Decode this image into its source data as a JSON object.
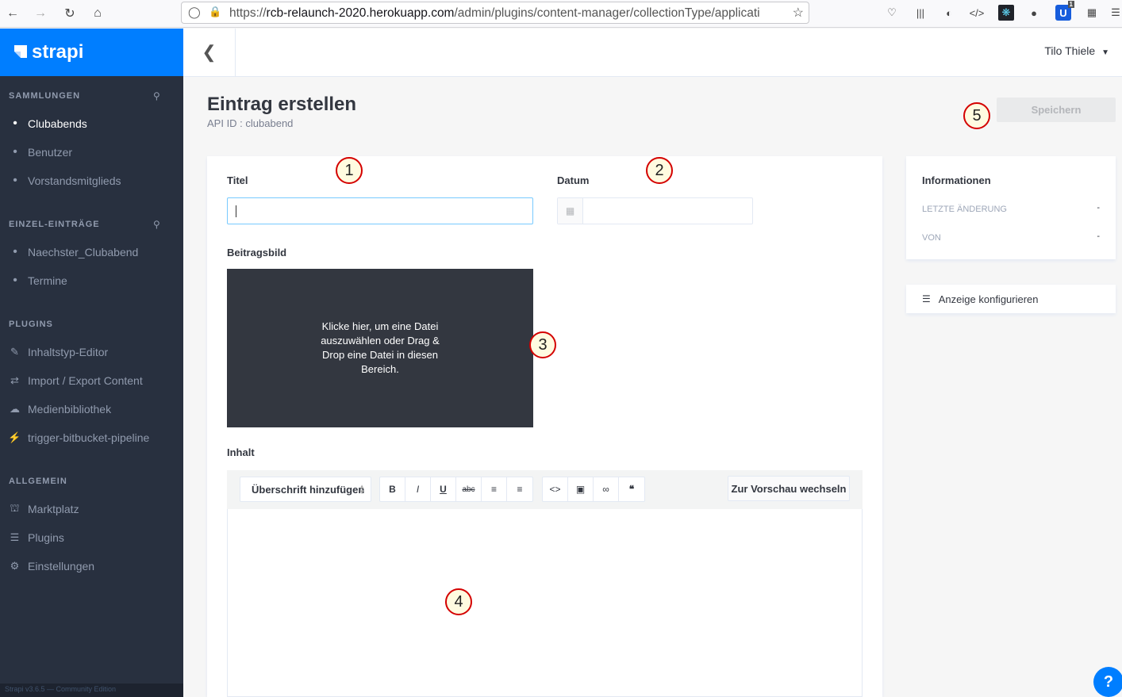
{
  "browser": {
    "url_prefix": "https://",
    "url_host": "rcb-relaunch-2020.herokuapp.com",
    "url_path": "/admin/plugins/content-manager/collectionType/applicati",
    "ext_badge": "1"
  },
  "sidebar": {
    "brand": "strapi",
    "sections": {
      "collections": "Sammlungen",
      "single": "Einzel-Einträge",
      "plugins": "Plugins",
      "general": "Allgemein"
    },
    "collections": [
      "Clubabends",
      "Benutzer",
      "Vorstandsmitglieds"
    ],
    "single": [
      "Naechster_Clubabend",
      "Termine"
    ],
    "plugins": [
      "Inhaltstyp-Editor",
      "Import / Export Content",
      "Medienbibliothek",
      "trigger-bitbucket-pipeline"
    ],
    "general": [
      "Marktplatz",
      "Plugins",
      "Einstellungen"
    ],
    "footer": "Strapi v3.6.5 — Community Edition"
  },
  "header": {
    "user": "Tilo Thiele"
  },
  "page": {
    "title": "Eintrag erstellen",
    "api_id": "API ID : clubabend",
    "save": "Speichern"
  },
  "form": {
    "titel_label": "Titel",
    "datum_label": "Datum",
    "bild_label": "Beitragsbild",
    "dropzone_text": "Klicke hier, um eine Datei auszuwählen oder Drag & Drop eine Datei in diesen Bereich.",
    "inhalt_label": "Inhalt",
    "heading_select": "Überschrift hinzufügen",
    "toolbar": {
      "bold": "B",
      "italic": "I",
      "underline": "U",
      "strike": "abc"
    },
    "preview": "Zur Vorschau wechseln"
  },
  "info": {
    "title": "Informationen",
    "last_change_label": "Letzte Änderung",
    "last_change_value": "-",
    "by_label": "Von",
    "by_value": "-",
    "configure": "Anzeige konfigurieren"
  },
  "markers": [
    "1",
    "2",
    "3",
    "4",
    "5"
  ],
  "help": "?"
}
